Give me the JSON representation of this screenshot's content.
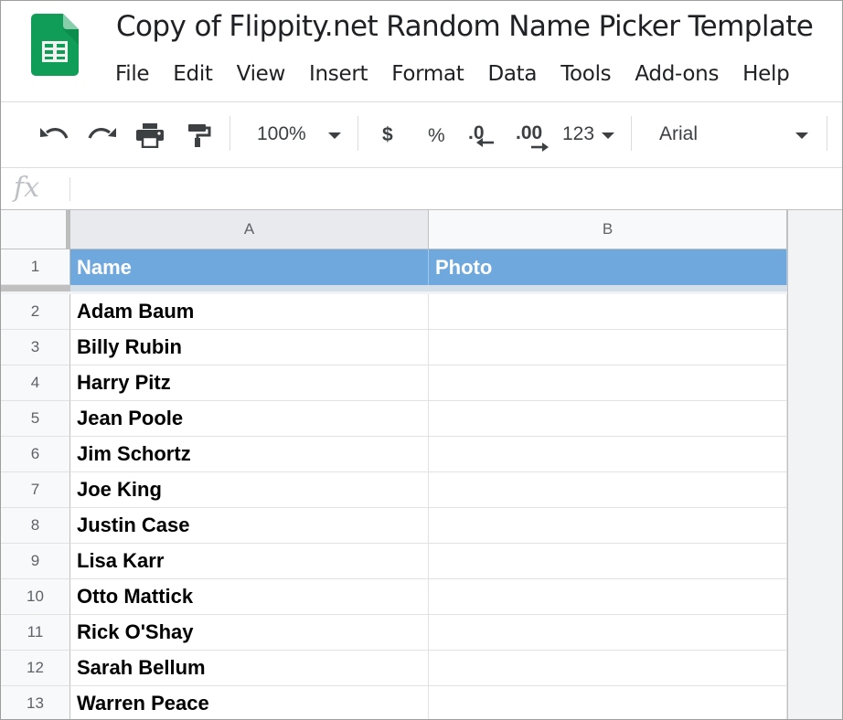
{
  "app": {
    "document_title": "Copy of Flippity.net Random Name Picker Template",
    "logo_icon": "google-sheets-logo",
    "logo_color": "#0F9D58"
  },
  "menu": [
    "File",
    "Edit",
    "View",
    "Insert",
    "Format",
    "Data",
    "Tools",
    "Add-ons",
    "Help"
  ],
  "toolbar": {
    "undo_icon": "undo-icon",
    "redo_icon": "redo-icon",
    "print_icon": "print-icon",
    "paint_format_icon": "paint-format-icon",
    "zoom": "100%",
    "currency": "$",
    "percent": "%",
    "decrease_decimal": ".0",
    "increase_decimal": ".00",
    "more_formats": "123",
    "font": "Arial"
  },
  "formula_bar": {
    "label": "fx",
    "value": ""
  },
  "grid": {
    "columns": [
      "A",
      "B"
    ],
    "header_color": "#6FA8DC",
    "header_row": {
      "number": "1",
      "cells": [
        "Name",
        "Photo"
      ]
    },
    "rows": [
      {
        "number": "2",
        "name": "Adam Baum",
        "photo": ""
      },
      {
        "number": "3",
        "name": "Billy Rubin",
        "photo": ""
      },
      {
        "number": "4",
        "name": "Harry Pitz",
        "photo": ""
      },
      {
        "number": "5",
        "name": "Jean Poole",
        "photo": ""
      },
      {
        "number": "6",
        "name": "Jim Schortz",
        "photo": ""
      },
      {
        "number": "7",
        "name": "Joe King",
        "photo": ""
      },
      {
        "number": "8",
        "name": "Justin Case",
        "photo": ""
      },
      {
        "number": "9",
        "name": "Lisa Karr",
        "photo": ""
      },
      {
        "number": "10",
        "name": "Otto Mattick",
        "photo": ""
      },
      {
        "number": "11",
        "name": "Rick O'Shay",
        "photo": ""
      },
      {
        "number": "12",
        "name": "Sarah Bellum",
        "photo": ""
      },
      {
        "number": "13",
        "name": "Warren Peace",
        "photo": ""
      }
    ]
  }
}
